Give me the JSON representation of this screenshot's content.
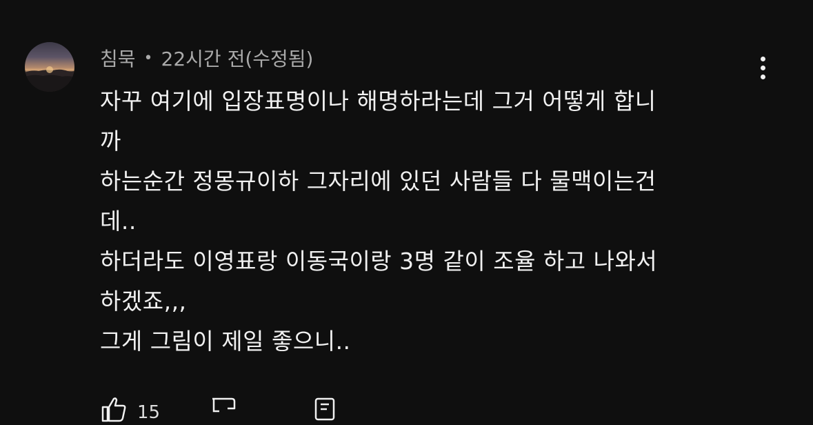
{
  "comment": {
    "author": "침묵",
    "separator": "•",
    "timestamp": "22시간 전(수정됨)",
    "lines": [
      "자꾸 여기에 입장표명이나 해명하라는데 그거 어떻게 합니",
      "까",
      "하는순간 정몽규이하 그자리에 있던 사람들 다 물맥이는건",
      "데..",
      "하더라도 이영표랑 이동국이랑 3명 같이 조율 하고 나와서",
      "하겠죠,,,",
      "그게 그림이 제일 좋으니.."
    ],
    "like_count": "15",
    "icons": {
      "avatar": "sunset-mountain-avatar",
      "menu": "more-vert-icon",
      "like": "thumb-up-icon",
      "dislike": "thumb-down-icon",
      "reply": "reply-icon"
    }
  },
  "colors": {
    "background": "#0f0f0f",
    "text": "#f1f1f1",
    "secondary_text": "#aaaaaa"
  }
}
